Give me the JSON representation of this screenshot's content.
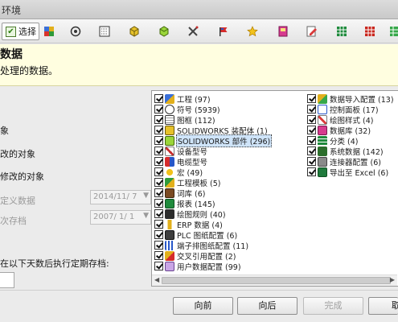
{
  "window": {
    "title": "环境"
  },
  "toolbar": {
    "select_label": "选择",
    "icons": [
      "solidworks-parts-icon",
      "symbol-icon",
      "drawing-frame-icon",
      "assembly-icon",
      "solidworks-part-icon",
      "tools-icon",
      "flag-icon",
      "star-icon",
      "device-icon",
      "pencil-form-icon",
      "table-icon",
      "grid-icon",
      "green-table-icon"
    ]
  },
  "banner": {
    "title": "数据",
    "description": "处理的数据。"
  },
  "options": {
    "o1": "",
    "o2": "象",
    "o3": "改的对象",
    "o4": "修改的对象",
    "o5": "定义数据",
    "o6": "次存档",
    "o7": "在以下天数后执行定期存档:"
  },
  "dates": {
    "d1": "2014/11/ 7",
    "d2": "2007/ 1/ 1"
  },
  "list_left": [
    {
      "label": "工程 (97)",
      "icon": "project-icon"
    },
    {
      "label": "符号 (5939)",
      "icon": "symbol-icon"
    },
    {
      "label": "图框 (112)",
      "icon": "frame-icon"
    },
    {
      "label": "SOLIDWORKS 装配体 (1)",
      "icon": "assembly-icon"
    },
    {
      "label": "SOLIDWORKS 部件 (296)",
      "icon": "part-icon",
      "selected": true
    },
    {
      "label": "设备型号",
      "icon": "device-model-icon"
    },
    {
      "label": "电缆型号",
      "icon": "cable-model-icon"
    },
    {
      "label": "宏 (49)",
      "icon": "macro-icon"
    },
    {
      "label": "工程模板 (5)",
      "icon": "project-template-icon"
    },
    {
      "label": "词库 (6)",
      "icon": "dictionary-icon"
    },
    {
      "label": "报表 (145)",
      "icon": "report-icon"
    },
    {
      "label": "绘图规则 (40)",
      "icon": "drawing-rules-icon"
    },
    {
      "label": "ERP 数据 (4)",
      "icon": "erp-icon"
    },
    {
      "label": "PLC 图纸配置 (6)",
      "icon": "plc-icon"
    },
    {
      "label": "端子排图纸配置 (11)",
      "icon": "terminal-strip-icon"
    },
    {
      "label": "交叉引用配置 (2)",
      "icon": "cross-reference-icon"
    },
    {
      "label": "用户数据配置 (99)",
      "icon": "user-data-icon"
    }
  ],
  "list_right": [
    {
      "label": "数据导入配置 (13)",
      "icon": "data-import-icon"
    },
    {
      "label": "控制面板 (17)",
      "icon": "control-panel-icon"
    },
    {
      "label": "绘图样式 (4)",
      "icon": "drawing-style-icon"
    },
    {
      "label": "数据库 (32)",
      "icon": "database-icon"
    },
    {
      "label": "分类 (4)",
      "icon": "classification-icon"
    },
    {
      "label": "系统数据 (142)",
      "icon": "system-data-icon"
    },
    {
      "label": "连接器配置 (6)",
      "icon": "connector-icon"
    },
    {
      "label": "导出至 Excel (6)",
      "icon": "excel-export-icon"
    }
  ],
  "buttons": {
    "back": "向前",
    "next": "向后",
    "finish": "完成",
    "cancel": "取"
  },
  "colors": {
    "banner_bg": "#fffee0",
    "selection": "#cfe4f9",
    "check": "#111111"
  }
}
